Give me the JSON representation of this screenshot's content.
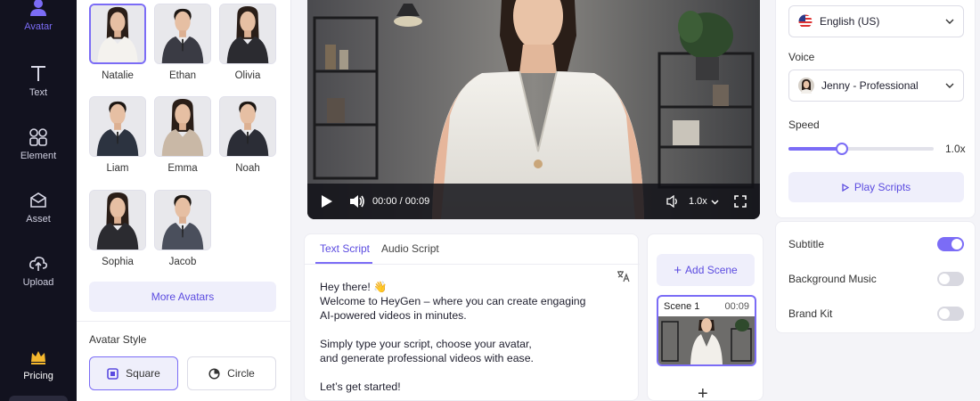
{
  "nav": {
    "items": [
      {
        "label": "Avatar",
        "icon": "user-icon"
      },
      {
        "label": "Text",
        "icon": "text-icon"
      },
      {
        "label": "Element",
        "icon": "element-icon"
      },
      {
        "label": "Asset",
        "icon": "asset-icon"
      },
      {
        "label": "Upload",
        "icon": "upload-icon"
      }
    ],
    "pricing": {
      "label": "Pricing",
      "icon": "crown-icon"
    },
    "accent": "#7b6cf6"
  },
  "avatars": {
    "items": [
      {
        "name": "Natalie",
        "selected": true,
        "gender": "f"
      },
      {
        "name": "Ethan",
        "gender": "m"
      },
      {
        "name": "Olivia",
        "gender": "f"
      },
      {
        "name": "Liam",
        "gender": "m"
      },
      {
        "name": "Emma",
        "gender": "f"
      },
      {
        "name": "Noah",
        "gender": "m"
      },
      {
        "name": "Sophia",
        "gender": "f"
      },
      {
        "name": "Jacob",
        "gender": "m"
      }
    ],
    "more_label": "More Avatars",
    "style_title": "Avatar Style",
    "style_options": [
      {
        "label": "Square",
        "active": true
      },
      {
        "label": "Circle",
        "active": false
      }
    ]
  },
  "player": {
    "time": "00:00 / 00:09",
    "speed": "1.0x"
  },
  "script": {
    "tabs": [
      {
        "label": "Text Script",
        "active": true
      },
      {
        "label": "Audio Script",
        "active": false
      }
    ],
    "paragraphs": [
      "Hey there! 👋\nWelcome to HeyGen – where you can create engaging\nAI-powered videos in minutes.",
      "Simply type your script, choose your avatar,\nand generate professional videos with ease.",
      "Let’s get started!"
    ]
  },
  "scenes": {
    "add_label": "Add Scene",
    "items": [
      {
        "name": "Scene 1",
        "duration": "00:09"
      }
    ]
  },
  "settings": {
    "language": "English (US)",
    "voice_label": "Voice",
    "voice": "Jenny - Professional",
    "speed_label": "Speed",
    "speed_value": "1.0x",
    "speed_fraction": 0.37,
    "play_label": "Play Scripts",
    "toggles": [
      {
        "label": "Subtitle",
        "on": true
      },
      {
        "label": "Background Music",
        "on": false
      },
      {
        "label": "Brand Kit",
        "on": false
      }
    ]
  }
}
